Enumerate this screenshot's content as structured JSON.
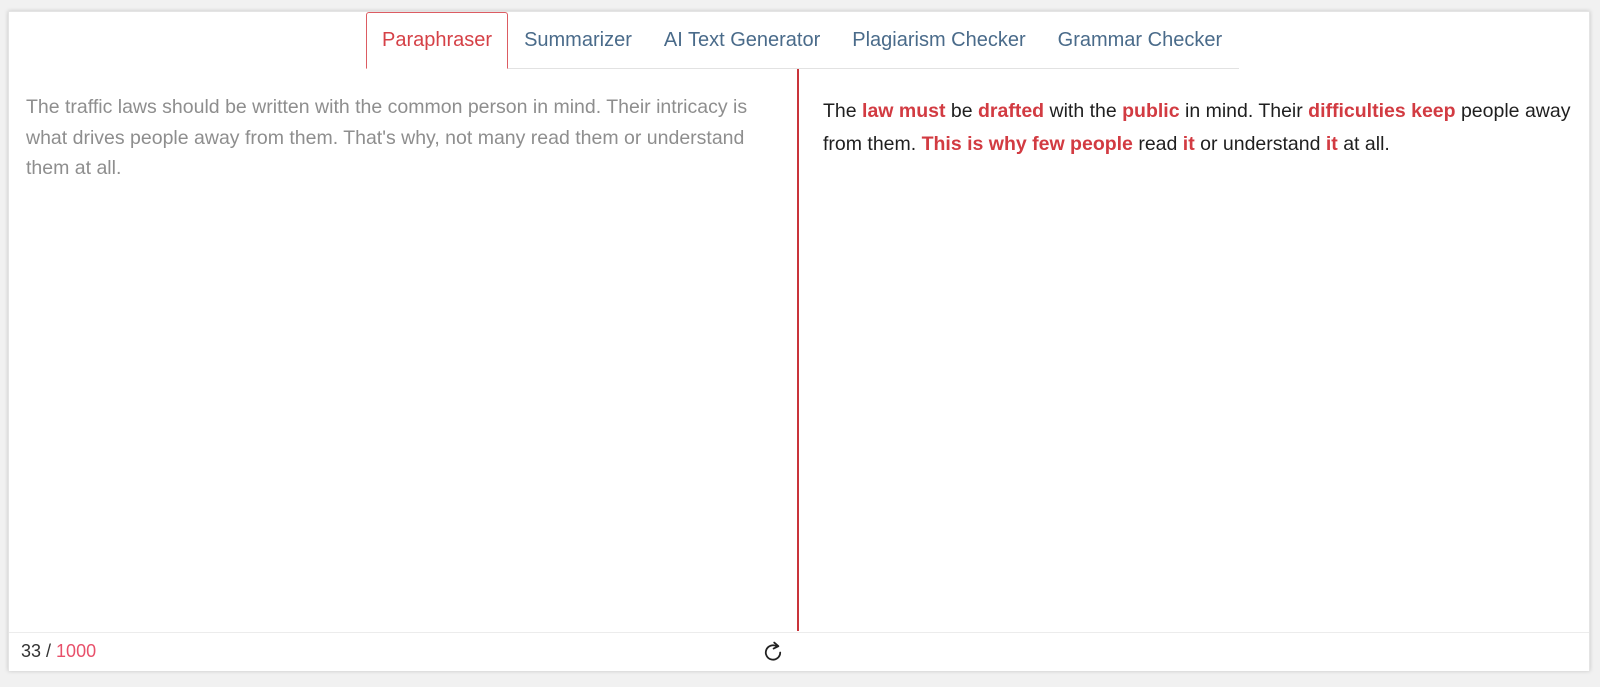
{
  "tabs": [
    {
      "label": "Paraphraser",
      "active": true
    },
    {
      "label": "Summarizer",
      "active": false
    },
    {
      "label": "AI Text Generator",
      "active": false
    },
    {
      "label": "Plagiarism Checker",
      "active": false
    },
    {
      "label": "Grammar Checker",
      "active": false
    }
  ],
  "input": {
    "text": "The traffic laws should be written with the common person in mind. Their intricacy is what drives people away from them. That's why, not many read them or understand them at all."
  },
  "output": {
    "segments": [
      {
        "text": "The ",
        "changed": false
      },
      {
        "text": "law must",
        "changed": true
      },
      {
        "text": " be ",
        "changed": false
      },
      {
        "text": "drafted",
        "changed": true
      },
      {
        "text": " with the ",
        "changed": false
      },
      {
        "text": "public",
        "changed": true
      },
      {
        "text": " in mind. Their ",
        "changed": false
      },
      {
        "text": "difficulties keep",
        "changed": true
      },
      {
        "text": " people away from them. ",
        "changed": false
      },
      {
        "text": "This is why few people",
        "changed": true
      },
      {
        "text": " read ",
        "changed": false
      },
      {
        "text": "it",
        "changed": true
      },
      {
        "text": " or understand ",
        "changed": false
      },
      {
        "text": "it",
        "changed": true
      },
      {
        "text": " at all.",
        "changed": false
      }
    ]
  },
  "footer": {
    "word_count": "33",
    "separator": " / ",
    "max": "1000",
    "refresh_icon": "refresh-icon"
  },
  "colors": {
    "accent": "#d54147",
    "tab_text": "#4a6b8a",
    "divider": "#c9343a",
    "counter_max": "#e8506a"
  }
}
